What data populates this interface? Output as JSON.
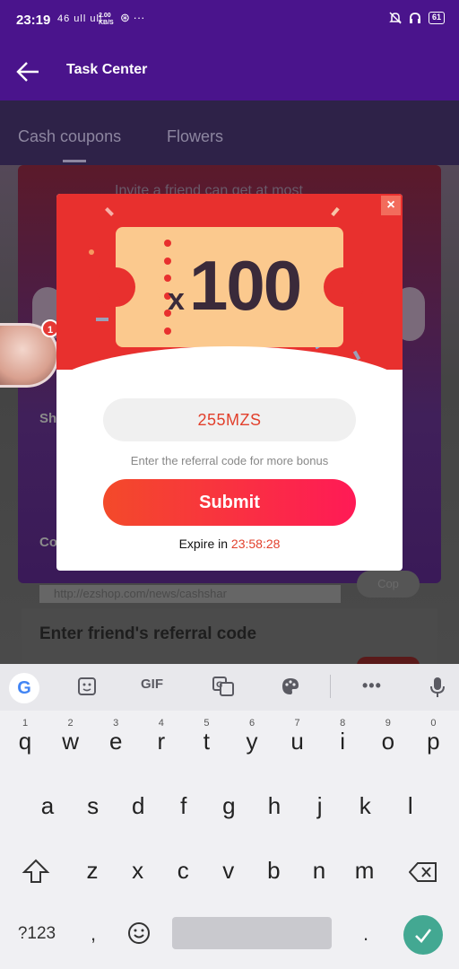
{
  "status_bar": {
    "time": "23:19",
    "signal": "46 ull ull",
    "net_speed_top": "2.00",
    "net_speed_bottom": "KB/S",
    "extra": "⊛ ···",
    "battery": "61"
  },
  "app_bar": {
    "title": "Task Center"
  },
  "background": {
    "tabs": [
      "Cash coupons",
      "Flowers"
    ],
    "invite_text": "Invite a friend can get at most",
    "share_label": "Sh",
    "copy_label": "Co",
    "link_text": "http://ezshop.com/news/cashshar",
    "copy_button": "Cop",
    "section_title": "Enter friend's referral code"
  },
  "avatar_badge": "1",
  "popup": {
    "close": "×",
    "ticket_multiplier": "x",
    "ticket_amount": "100",
    "referral_code": "255MZS",
    "hint": "Enter the referral code for more bonus",
    "submit": "Submit",
    "expire_label": "Expire in",
    "expire_time": "23:58:28"
  },
  "keyboard": {
    "toolbar": {
      "gif": "GIF"
    },
    "row1": [
      {
        "k": "q",
        "n": "1"
      },
      {
        "k": "w",
        "n": "2"
      },
      {
        "k": "e",
        "n": "3"
      },
      {
        "k": "r",
        "n": "4"
      },
      {
        "k": "t",
        "n": "5"
      },
      {
        "k": "y",
        "n": "6"
      },
      {
        "k": "u",
        "n": "7"
      },
      {
        "k": "i",
        "n": "8"
      },
      {
        "k": "o",
        "n": "9"
      },
      {
        "k": "p",
        "n": "0"
      }
    ],
    "row2": [
      "a",
      "s",
      "d",
      "f",
      "g",
      "h",
      "j",
      "k",
      "l"
    ],
    "row3": [
      "z",
      "x",
      "c",
      "v",
      "b",
      "n",
      "m"
    ],
    "symbols": "?123",
    "comma": ",",
    "period": "."
  },
  "colors": {
    "primary": "#4a148c",
    "accent_red": "#e8302e",
    "submit_end": "#ff1a56",
    "ticket": "#fbc98e"
  }
}
